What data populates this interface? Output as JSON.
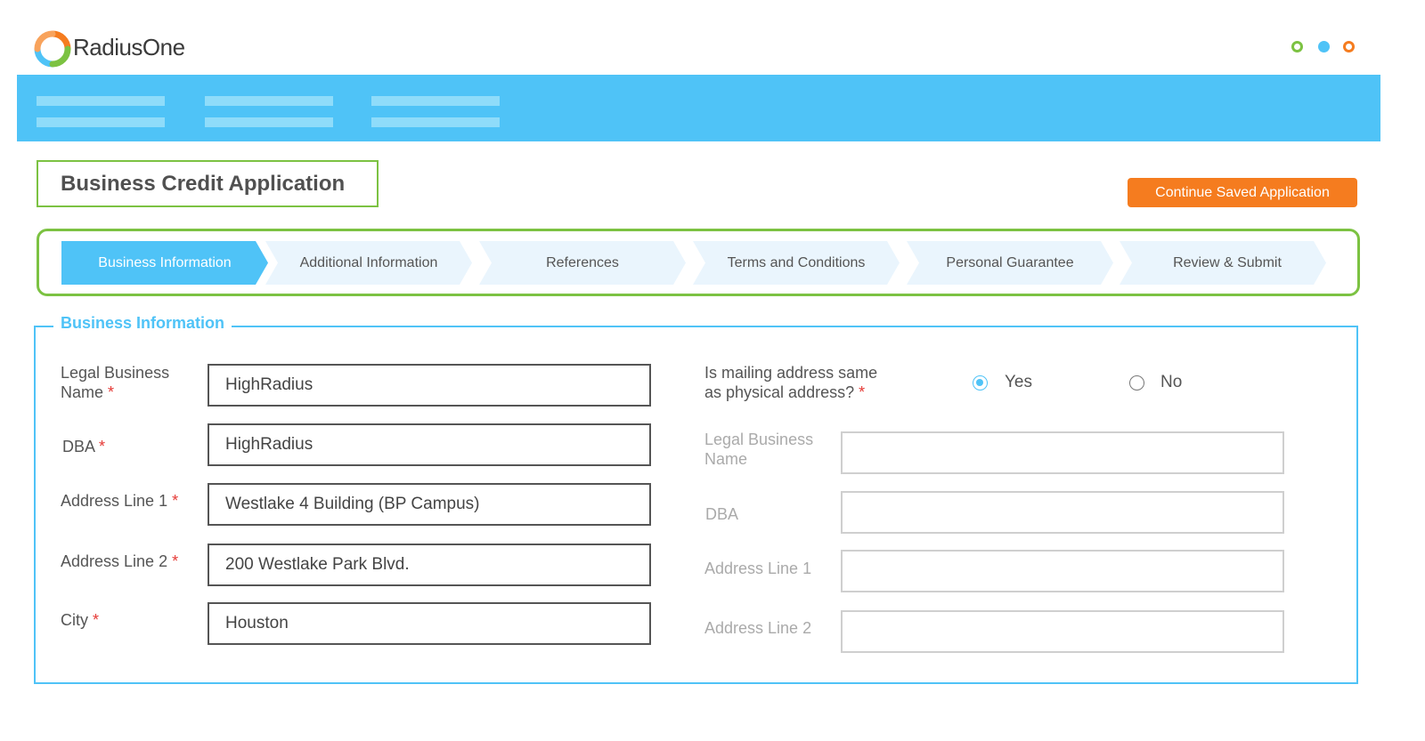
{
  "app": {
    "brand": "RadiusOne",
    "title": "Business Credit Application",
    "continue_button": "Continue Saved Application",
    "colors": {
      "accent_blue": "#4fc3f7",
      "accent_green": "#7cc242",
      "accent_orange": "#f57c1f"
    }
  },
  "steps": [
    {
      "label": "Business Information",
      "active": true
    },
    {
      "label": "Additional Information",
      "active": false
    },
    {
      "label": "References",
      "active": false
    },
    {
      "label": "Terms and Conditions",
      "active": false
    },
    {
      "label": "Personal Guarantee",
      "active": false
    },
    {
      "label": "Review & Submit",
      "active": false
    }
  ],
  "section": {
    "legend": "Business Information",
    "physical": {
      "legal_name_label_1": "Legal Business",
      "legal_name_label_2": "Name",
      "legal_name_value": "HighRadius",
      "dba_label": "DBA",
      "dba_value": "HighRadius",
      "address1_label": "Address Line 1",
      "address1_value": "Westlake 4 Building (BP Campus)",
      "address2_label": "Address Line 2",
      "address2_value": "200 Westlake Park Blvd.",
      "city_label": "City",
      "city_value": "Houston",
      "required_mark": "*"
    },
    "mailing": {
      "question_1": "Is mailing address same",
      "question_2": "as physical address?",
      "yes_label": "Yes",
      "no_label": "No",
      "selected": "Yes",
      "legal_name_label_1": "Legal Business",
      "legal_name_label_2": "Name",
      "dba_label": "DBA",
      "address1_label": "Address Line 1",
      "address2_label": "Address Line 2"
    }
  }
}
